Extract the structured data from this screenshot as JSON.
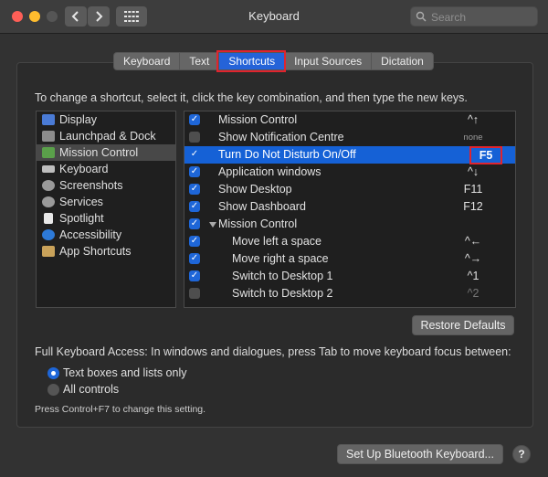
{
  "window": {
    "title": "Keyboard"
  },
  "search": {
    "placeholder": "Search"
  },
  "tabs": [
    {
      "label": "Keyboard"
    },
    {
      "label": "Text"
    },
    {
      "label": "Shortcuts",
      "active": true
    },
    {
      "label": "Input Sources"
    },
    {
      "label": "Dictation"
    }
  ],
  "instruction": "To change a shortcut, select it, click the key combination, and then type the new keys.",
  "categories": [
    {
      "label": "Display",
      "icon": "display-icon",
      "color": "#4a7bd6"
    },
    {
      "label": "Launchpad & Dock",
      "icon": "launchpad-icon",
      "color": "#8c8c8c"
    },
    {
      "label": "Mission Control",
      "icon": "mission-control-icon",
      "color": "#5aa04a",
      "selected": true
    },
    {
      "label": "Keyboard",
      "icon": "keyboard-icon",
      "color": "#bdbdbd"
    },
    {
      "label": "Screenshots",
      "icon": "screenshot-icon",
      "color": "#9a9a9a"
    },
    {
      "label": "Services",
      "icon": "gear-icon",
      "color": "#9a9a9a"
    },
    {
      "label": "Spotlight",
      "icon": "spotlight-icon",
      "color": "#e8e8e8"
    },
    {
      "label": "Accessibility",
      "icon": "accessibility-icon",
      "color": "#2d7ad8"
    },
    {
      "label": "App Shortcuts",
      "icon": "app-shortcuts-icon",
      "color": "#c9a25a"
    }
  ],
  "shortcuts": [
    {
      "label": "Mission Control",
      "checked": true,
      "key": "^↑"
    },
    {
      "label": "Show Notification Centre",
      "checked": false,
      "key": "none"
    },
    {
      "label": "Turn Do Not Disturb On/Off",
      "checked": true,
      "key": "F5",
      "selected": true
    },
    {
      "label": "Application windows",
      "checked": true,
      "key": "^↓"
    },
    {
      "label": "Show Desktop",
      "checked": true,
      "key": "F11"
    },
    {
      "label": "Show Dashboard",
      "checked": true,
      "key": "F12"
    },
    {
      "label": "Mission Control",
      "checked": true,
      "key": "",
      "group": true
    },
    {
      "label": "Move left a space",
      "checked": true,
      "key": "^←",
      "indent": true
    },
    {
      "label": "Move right a space",
      "checked": true,
      "key": "^→",
      "indent": true
    },
    {
      "label": "Switch to Desktop 1",
      "checked": true,
      "key": "^1",
      "indent": true
    },
    {
      "label": "Switch to Desktop 2",
      "checked": false,
      "key": "^2",
      "indent": true
    }
  ],
  "restore_defaults": "Restore Defaults",
  "full_access": {
    "text": "Full Keyboard Access: In windows and dialogues, press Tab to move keyboard focus between:",
    "options": [
      {
        "label": "Text boxes and lists only",
        "selected": true
      },
      {
        "label": "All controls",
        "selected": false
      }
    ],
    "note": "Press Control+F7 to change this setting."
  },
  "bluetooth_button": "Set Up Bluetooth Keyboard...",
  "help": "?",
  "colors": {
    "accent": "#1561d6",
    "highlight_border": "#e0242e"
  }
}
